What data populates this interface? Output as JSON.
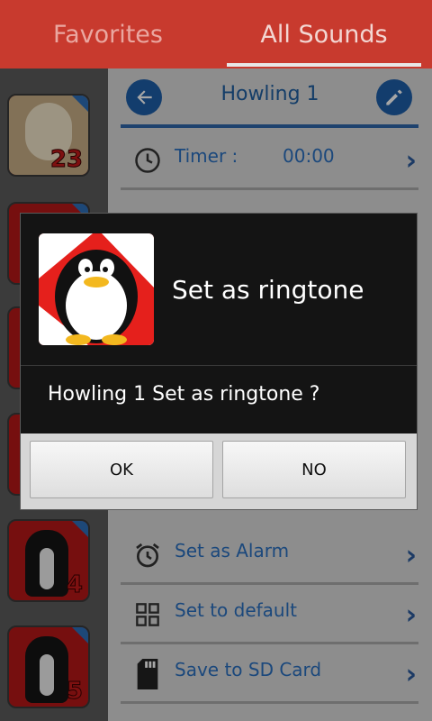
{
  "tabs": {
    "favorites": "Favorites",
    "all_sounds": "All Sounds"
  },
  "left_list": {
    "numbers": [
      "23",
      "4",
      "5"
    ]
  },
  "panel": {
    "title": "Howling 1",
    "rows": [
      {
        "label": "Timer :",
        "value": "00:00",
        "icon": "clock-icon"
      },
      {
        "label": "Set as Alarm",
        "value": "",
        "icon": "alarm-clock-icon"
      },
      {
        "label": "Set to default",
        "value": "",
        "icon": "grid-icon"
      },
      {
        "label": "Save to SD Card",
        "value": "",
        "icon": "sd-card-icon"
      }
    ]
  },
  "dialog": {
    "title": "Set as ringtone",
    "message": "Howling 1 Set as ringtone ?",
    "ok_label": "OK",
    "no_label": "NO"
  },
  "colors": {
    "tab_bar": "#c83a2e",
    "accent_blue": "#2a6fbf",
    "dialog_bg": "#141414"
  }
}
